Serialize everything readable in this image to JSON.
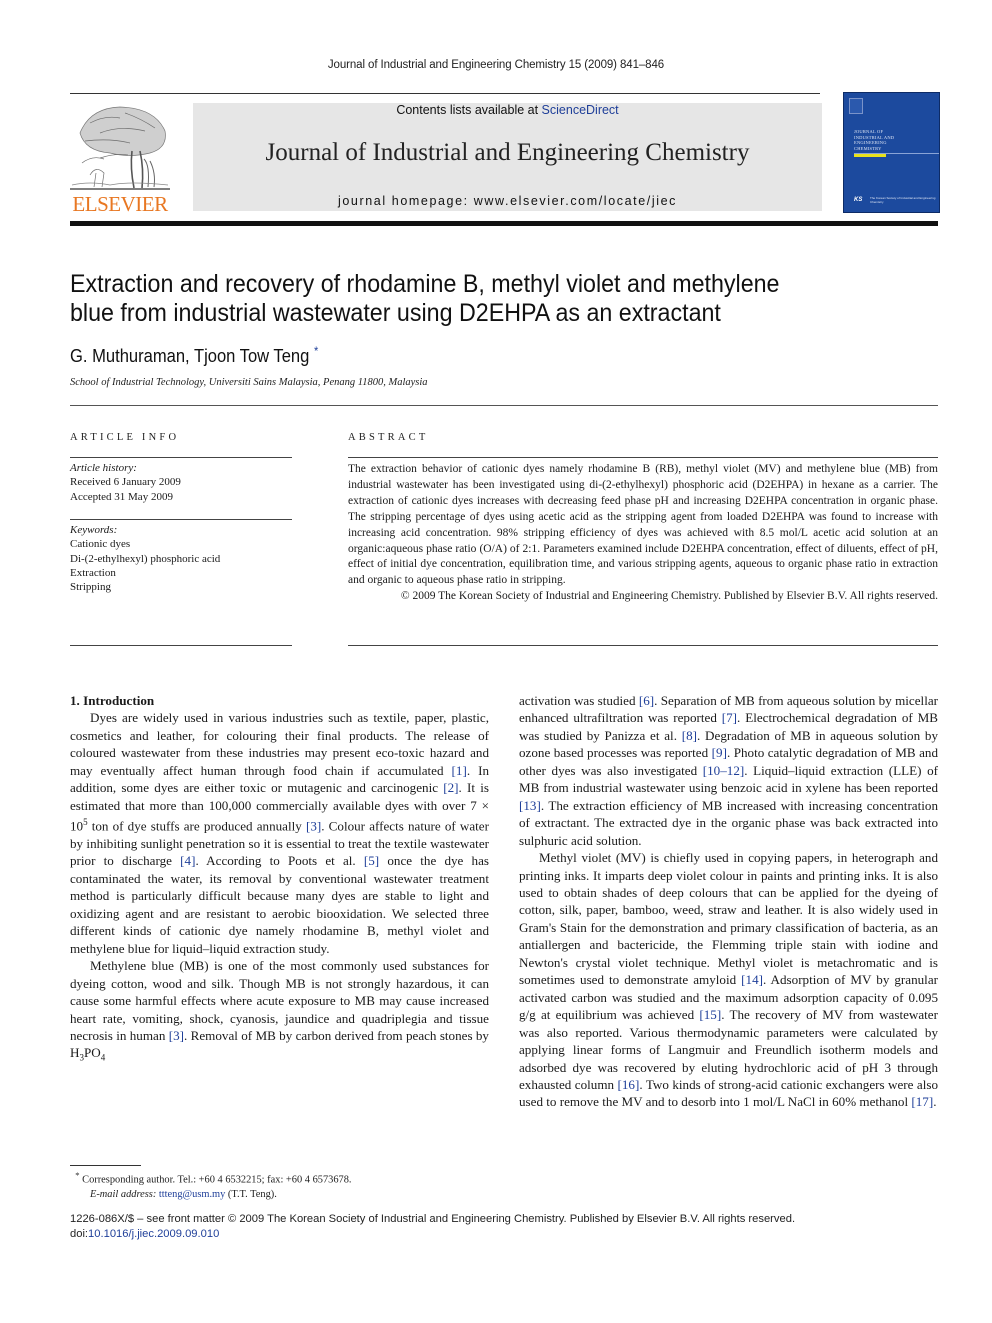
{
  "running_head": "Journal of Industrial and Engineering Chemistry 15 (2009) 841–846",
  "header": {
    "publisher_logo_text": "ELSEVIER",
    "contents_prefix": "Contents lists available at ",
    "contents_link": "ScienceDirect",
    "journal_title": "Journal of Industrial and Engineering Chemistry",
    "homepage": "journal homepage: www.elsevier.com/locate/jiec",
    "cover": {
      "title_lines": [
        "JOURNAL OF",
        "INDUSTRIAL AND",
        "ENGINEERING",
        "CHEMISTRY"
      ],
      "society_mark": "KS",
      "society_text": "The Korean Society of Industrial and Engineering Chemistry",
      "background_color": "#1c4a9e",
      "accent_bar_color": "#e7e21c"
    }
  },
  "article": {
    "title_line1": "Extraction and recovery of rhodamine B, methyl violet and methylene",
    "title_line2": "blue from industrial wastewater using D2EHPA as an extractant",
    "authors": "G. Muthuraman, Tjoon Tow Teng",
    "corresponding_marker": "*",
    "affiliation": "School of Industrial Technology, Universiti Sains Malaysia, Penang 11800, Malaysia"
  },
  "article_info": {
    "label": "ARTICLE INFO",
    "history_label": "Article history:",
    "received": "Received 6 January 2009",
    "accepted": "Accepted 31 May 2009",
    "keywords_label": "Keywords:",
    "keywords": [
      "Cationic dyes",
      "Di-(2-ethylhexyl) phosphoric acid",
      "Extraction",
      "Stripping"
    ]
  },
  "abstract": {
    "label": "ABSTRACT",
    "text": "The extraction behavior of cationic dyes namely rhodamine B (RB), methyl violet (MV) and methylene blue (MB) from industrial wastewater has been investigated using di-(2-ethylhexyl) phosphoric acid (D2EHPA) in hexane as a carrier. The extraction of cationic dyes increases with decreasing feed phase pH and increasing D2EHPA concentration in organic phase. The stripping percentage of dyes using acetic acid as the stripping agent from loaded D2EHPA was found to increase with increasing acid concentration. 98% stripping efficiency of dyes was achieved with 8.5 mol/L acetic acid solution at an organic:aqueous phase ratio (O/A) of 2:1. Parameters examined include D2EHPA concentration, effect of diluents, effect of pH, effect of initial dye concentration, equilibration time, and various stripping agents, aqueous to organic phase ratio in extraction and organic to aqueous phase ratio in stripping.",
    "copyright": "© 2009 The Korean Society of Industrial and Engineering Chemistry. Published by Elsevier B.V. All rights reserved."
  },
  "body": {
    "section_heading": "1.  Introduction",
    "p1": [
      "Dyes are widely used in various industries such as textile, paper, plastic, cosmetics and leather, for colouring their final products. The release of coloured wastewater from these industries may present eco-toxic hazard and may eventually affect human through food chain if accumulated ",
      "[1]",
      ". In addition, some dyes are either toxic or mutagenic and carcinogenic ",
      "[2]",
      ". It is estimated that more than 100,000 commercially available dyes with over 7 × 10",
      "5",
      " ton of dye stuffs are produced annually ",
      "[3]",
      ". Colour affects nature of water by inhibiting sunlight penetration so it is essential to treat the textile wastewater prior to discharge ",
      "[4]",
      ". According to Poots et al. ",
      "[5]",
      " once the dye has contaminated the water, its removal by conventional wastewater treatment method is particularly difficult because many dyes are stable to light and oxidizing agent and are resistant to aerobic biooxidation. We selected three different kinds of cationic dye namely rhodamine B, methyl violet and methylene blue for liquid–liquid extraction study."
    ],
    "p2": [
      "Methylene blue (MB) is one of the most commonly used substances for dyeing cotton, wood and silk. Though MB is not strongly hazardous, it can cause some harmful effects where acute exposure to MB may cause increased heart rate, vomiting, shock, cyanosis, jaundice and quadriplegia and tissue necrosis in human ",
      "[3]",
      ". Removal of MB by carbon derived from peach stones by H",
      "3",
      "PO",
      "4"
    ],
    "p2_cont": [
      "activation was studied ",
      "[6]",
      ". Separation of MB from aqueous solution by micellar enhanced ultrafiltration was reported ",
      "[7]",
      ". Electrochemical degradation of MB was studied by Panizza et al. ",
      "[8]",
      ". Degradation of MB in aqueous solution by ozone based processes was reported ",
      "[9]",
      ". Photo catalytic degradation of MB and other dyes was also investigated ",
      "[10–12]",
      ". Liquid–liquid extraction (LLE) of MB from industrial wastewater using benzoic acid in xylene has been reported ",
      "[13]",
      ". The extraction efficiency of MB increased with increasing concentration of extractant. The extracted dye in the organic phase was back extracted into sulphuric acid solution."
    ],
    "p3": [
      "Methyl violet (MV) is chiefly used in copying papers, in heterograph and printing inks. It imparts deep violet colour in paints and printing inks. It is also used to obtain shades of deep colours that can be applied for the dyeing of cotton, silk, paper, bamboo, weed, straw and leather. It is also widely used in Gram's Stain for the demonstration and primary classification of bacteria, as an antiallergen and bactericide, the Flemming triple stain with iodine and Newton's crystal violet technique. Methyl violet is metachromatic and is sometimes used to demonstrate amyloid ",
      "[14]",
      ". Adsorption of MV by granular activated carbon was studied and the maximum adsorption capacity of 0.095 g/g at equilibrium was achieved ",
      "[15]",
      ". The recovery of MV from wastewater was also reported. Various thermodynamic parameters were calculated by applying linear forms of Langmuir and Freundlich isotherm models and adsorbed dye was recovered by eluting hydrochloric acid of pH 3 through exhausted column ",
      "[16]",
      ". Two kinds of strong-acid cationic exchangers were also used to remove the MV and to desorb into 1 mol/L NaCl in 60% methanol ",
      "[17]",
      "."
    ]
  },
  "footnote": {
    "marker": "*",
    "text": "Corresponding author. Tel.: +60 4 6532215; fax: +60 4 6573678.",
    "email_label": "E-mail address: ",
    "email": "ttteng@usm.my",
    "email_suffix": " (T.T. Teng)."
  },
  "bottom_meta": {
    "issn_line": "1226-086X/$ – see front matter © 2009 The Korean Society of Industrial and Engineering Chemistry. Published by Elsevier B.V. All rights reserved.",
    "doi_prefix": "doi:",
    "doi": "10.1016/j.jiec.2009.09.010"
  },
  "colors": {
    "link": "#1f3f99",
    "elsevier_orange": "#e87722",
    "banner_gray": "#e6e6e6"
  }
}
